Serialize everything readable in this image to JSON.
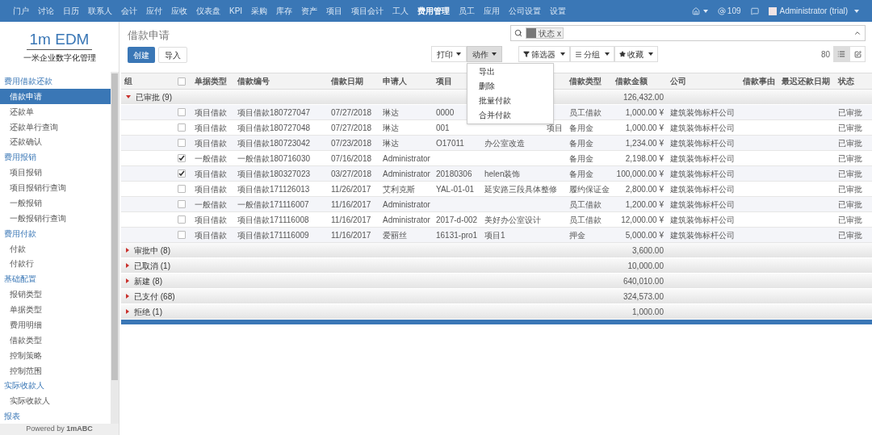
{
  "topnav": {
    "items": [
      {
        "label": "门户",
        "selected": false
      },
      {
        "label": "讨论",
        "selected": false
      },
      {
        "label": "日历",
        "selected": false
      },
      {
        "label": "联系人",
        "selected": false
      },
      {
        "label": "会计",
        "selected": false
      },
      {
        "label": "应付",
        "selected": false
      },
      {
        "label": "应收",
        "selected": false
      },
      {
        "label": "仪表盘",
        "selected": false
      },
      {
        "label": "KPI",
        "selected": false
      },
      {
        "label": "采购",
        "selected": false
      },
      {
        "label": "库存",
        "selected": false
      },
      {
        "label": "资产",
        "selected": false
      },
      {
        "label": "项目",
        "selected": false
      },
      {
        "label": "项目会计",
        "selected": false
      },
      {
        "label": "工人",
        "selected": false
      },
      {
        "label": "费用管理",
        "selected": true
      },
      {
        "label": "员工",
        "selected": false
      },
      {
        "label": "应用",
        "selected": false
      },
      {
        "label": "公司设置",
        "selected": false
      },
      {
        "label": "设置",
        "selected": false
      }
    ],
    "notifications": "109",
    "user": "Administrator (trial)"
  },
  "logo": {
    "title": "1m EDM",
    "subtitle": "一米企业数字化管理"
  },
  "sidebar": {
    "sections": [
      {
        "title": "费用借款还款",
        "items": [
          {
            "label": "借款申请",
            "selected": true
          },
          {
            "label": "还款单",
            "selected": false
          },
          {
            "label": "还款单行查询",
            "selected": false
          },
          {
            "label": "还款确认",
            "selected": false
          }
        ]
      },
      {
        "title": "费用报销",
        "items": [
          {
            "label": "项目报销",
            "selected": false
          },
          {
            "label": "项目报销行查询",
            "selected": false
          },
          {
            "label": "一般报销",
            "selected": false
          },
          {
            "label": "一般报销行查询",
            "selected": false
          }
        ]
      },
      {
        "title": "费用付款",
        "items": [
          {
            "label": "付款",
            "selected": false
          },
          {
            "label": "付款行",
            "selected": false
          }
        ]
      },
      {
        "title": "基础配置",
        "items": [
          {
            "label": "报销类型",
            "selected": false
          },
          {
            "label": "单据类型",
            "selected": false
          },
          {
            "label": "费用明细",
            "selected": false
          },
          {
            "label": "借款类型",
            "selected": false
          },
          {
            "label": "控制策略",
            "selected": false
          },
          {
            "label": "控制范围",
            "selected": false
          }
        ]
      },
      {
        "title": "实际收款人",
        "items": [
          {
            "label": "实际收款人",
            "selected": false
          }
        ]
      },
      {
        "title": "报表"
      }
    ],
    "footer": "Powered by **1mABC**"
  },
  "page": {
    "title": "借款申请",
    "buttons": [
      "创建",
      "导入"
    ],
    "search_facet": "状态",
    "facet_remove": "x",
    "print": "打印",
    "actions": {
      "label": "动作",
      "open": true,
      "items": [
        "导出",
        "删除",
        "批量付款",
        "合并付款"
      ]
    },
    "filters": "筛选器",
    "group_by": "分组",
    "favorites": "收藏",
    "pager": "80",
    "views": [
      {
        "kind": "list",
        "selected": true
      },
      {
        "kind": "form",
        "selected": false
      }
    ]
  },
  "table": {
    "all_checked": false,
    "columns": [
      "组",
      "单据类型",
      "借款编号",
      "借款日期",
      "申请人",
      "项目",
      "借款类型",
      "借款金额",
      "公司",
      "借款事由",
      "最迟还款日期",
      "状态"
    ],
    "groups": [
      {
        "label": "已审批 (9)",
        "expanded": true,
        "total": "126,432.00",
        "rows": [
          {
            "checked": false,
            "type": "项目借款",
            "number": "项目借款180727047",
            "date": "07/27/2018",
            "applicant": "琳达",
            "project": "0000",
            "project_name": "",
            "loan_type": "员工借款",
            "amount": "1,000.00 ¥",
            "company": "建筑装饰标杆公司",
            "status": "已审批"
          },
          {
            "checked": false,
            "type": "项目借款",
            "number": "项目借款180727048",
            "date": "07/27/2018",
            "applicant": "琳达",
            "project": "001",
            "project_name": "项目",
            "loan_type": "备用金",
            "amount": "1,000.00 ¥",
            "company": "建筑装饰标杆公司",
            "status": "已审批"
          },
          {
            "checked": false,
            "type": "项目借款",
            "number": "项目借款180723042",
            "date": "07/23/2018",
            "applicant": "琳达",
            "project": "O17011",
            "project_name": "办公室改造",
            "loan_type": "备用金",
            "amount": "1,234.00 ¥",
            "company": "建筑装饰标杆公司",
            "status": "已审批"
          },
          {
            "checked": true,
            "type": "一般借款",
            "number": "一般借款180716030",
            "date": "07/16/2018",
            "applicant": "Administrator",
            "project": "",
            "project_name": "",
            "loan_type": "备用金",
            "amount": "2,198.00 ¥",
            "company": "建筑装饰标杆公司",
            "status": "已审批"
          },
          {
            "checked": true,
            "type": "项目借款",
            "number": "项目借款180327023",
            "date": "03/27/2018",
            "applicant": "Administrator",
            "project": "20180306",
            "project_name": "helen装饰",
            "loan_type": "备用金",
            "amount": "100,000.00 ¥",
            "company": "建筑装饰标杆公司",
            "status": "已审批"
          },
          {
            "checked": false,
            "type": "项目借款",
            "number": "项目借款171126013",
            "date": "11/26/2017",
            "applicant": "艾利克斯",
            "project": "YAL-01-01",
            "project_name": "延安路三段具体整修",
            "loan_type": "履约保证金",
            "amount": "2,800.00 ¥",
            "company": "建筑装饰标杆公司",
            "status": "已审批"
          },
          {
            "checked": false,
            "type": "一般借款",
            "number": "一般借款171116007",
            "date": "11/16/2017",
            "applicant": "Administrator",
            "project": "",
            "project_name": "",
            "loan_type": "员工借款",
            "amount": "1,200.00 ¥",
            "company": "建筑装饰标杆公司",
            "status": "已审批"
          },
          {
            "checked": false,
            "type": "项目借款",
            "number": "项目借款171116008",
            "date": "11/16/2017",
            "applicant": "Administrator",
            "project": "2017-d-002",
            "project_name": "美好办公室设计",
            "loan_type": "员工借款",
            "amount": "12,000.00 ¥",
            "company": "建筑装饰标杆公司",
            "status": "已审批"
          },
          {
            "checked": false,
            "type": "项目借款",
            "number": "项目借款171116009",
            "date": "11/16/2017",
            "applicant": "爱丽丝",
            "project": "16131-pro1",
            "project_name": "项目1",
            "loan_type": "押金",
            "amount": "5,000.00 ¥",
            "company": "建筑装饰标杆公司",
            "status": "已审批"
          }
        ]
      },
      {
        "label": "审批中 (8)",
        "expanded": false,
        "total": "3,600.00"
      },
      {
        "label": "已取消 (1)",
        "expanded": false,
        "total": "10,000.00"
      },
      {
        "label": "新建 (8)",
        "expanded": false,
        "total": "640,010.00"
      },
      {
        "label": "已支付 (68)",
        "expanded": false,
        "total": "324,573.00"
      },
      {
        "label": "拒绝 (1)",
        "expanded": false,
        "total": "1,000.00"
      }
    ]
  }
}
